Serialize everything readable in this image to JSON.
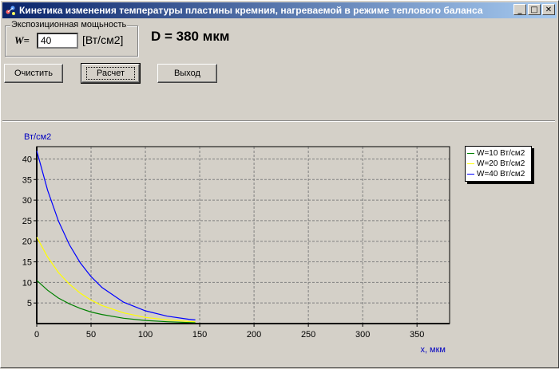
{
  "window": {
    "title": "Кинетика изменения температуры пластины кремния, нагреваемой в режиме теплового баланса",
    "minimize_glyph": "_",
    "maximize_glyph": "□",
    "close_glyph": "✕",
    "app_icon": "molecule-icon"
  },
  "power_group": {
    "label": "Экспозиционная мощьность",
    "symbol": "W=",
    "value": "40",
    "unit": "[Вт/см2]"
  },
  "thickness_label": "D = 380 мкм",
  "buttons": {
    "clear": "Очистить",
    "calculate": "Расчет",
    "exit": "Выход"
  },
  "chart_data": {
    "type": "line",
    "ylabel": "Вт/см2",
    "xlabel": "х, мкм",
    "xlim": [
      0,
      380
    ],
    "ylim": [
      0,
      43
    ],
    "x_ticks": [
      0,
      50,
      100,
      150,
      200,
      250,
      300,
      350
    ],
    "y_ticks": [
      5,
      10,
      15,
      20,
      25,
      30,
      35,
      40
    ],
    "grid": true,
    "legend_position": "top-right outside",
    "series": [
      {
        "name": "W=10 Вт/см2",
        "color": "#008000",
        "x": [
          0,
          10,
          20,
          30,
          40,
          50,
          60,
          80,
          100,
          120,
          140,
          146
        ],
        "y": [
          10.5,
          8.1,
          6.2,
          4.8,
          3.7,
          2.8,
          2.2,
          1.3,
          0.75,
          0.44,
          0.26,
          0.22
        ]
      },
      {
        "name": "W=20 Вт/см2",
        "color": "#ffff00",
        "x": [
          0,
          10,
          20,
          30,
          40,
          50,
          60,
          80,
          100,
          120,
          140,
          146
        ],
        "y": [
          21,
          16.2,
          12.4,
          9.6,
          7.4,
          5.7,
          4.4,
          2.6,
          1.5,
          0.9,
          0.5,
          0.45
        ]
      },
      {
        "name": "W=40 Вт/см2",
        "color": "#0000ff",
        "x": [
          0,
          10,
          20,
          30,
          40,
          50,
          60,
          80,
          100,
          120,
          140,
          146
        ],
        "y": [
          42,
          32.4,
          24.9,
          19.2,
          14.8,
          11.4,
          8.8,
          5.2,
          3.1,
          1.8,
          1.05,
          0.9
        ]
      }
    ]
  }
}
